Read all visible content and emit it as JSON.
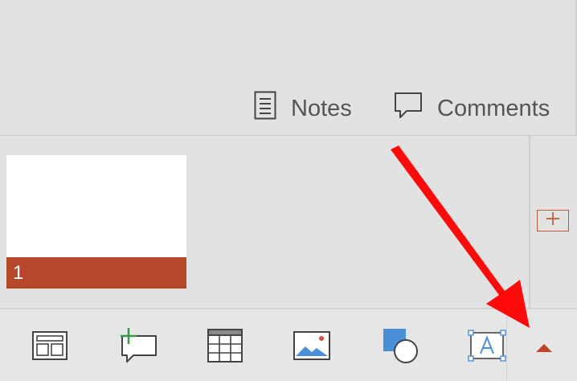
{
  "top_bar": {
    "notes_label": "Notes",
    "comments_label": "Comments"
  },
  "slides": [
    {
      "number": "1"
    }
  ],
  "toolbar": {
    "tools": [
      "layout-icon",
      "new-comment-icon",
      "table-icon",
      "picture-icon",
      "shapes-icon",
      "text-box-icon"
    ],
    "expand_icon": "triangle-up-icon"
  },
  "colors": {
    "accent": "#b5472b",
    "annotation_arrow": "#ff0a0a"
  }
}
